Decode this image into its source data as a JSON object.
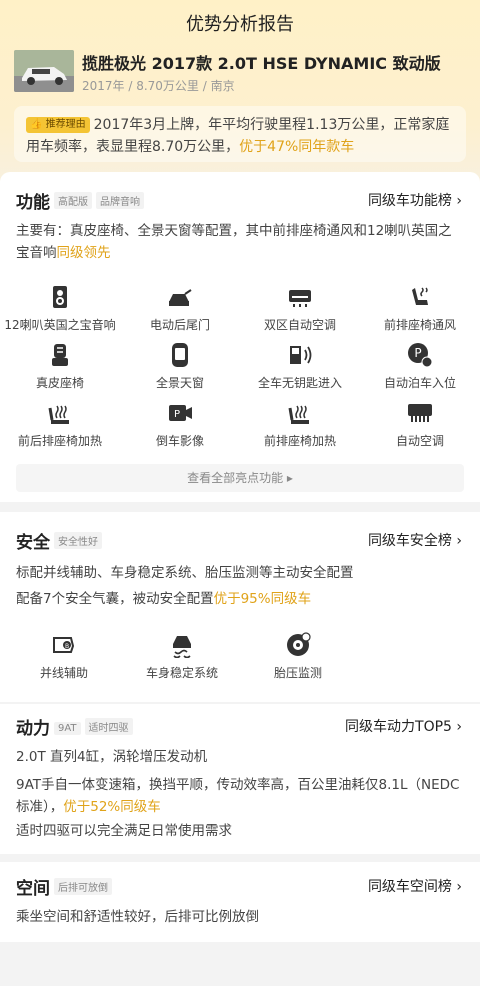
{
  "title": "优势分析报告",
  "car": {
    "name": "揽胜极光 2017款 2.0T HSE DYNAMIC 致动版",
    "meta": "2017年 / 8.70万公里 / 南京"
  },
  "recommend": {
    "badge": "推荐理由",
    "text": "2017年3月上牌，年平均行驶里程1.13万公里，正常家庭用车频率，表显里程8.70万公里，",
    "highlight": "优于47%同年款车"
  },
  "features": {
    "title": "功能",
    "tags": [
      "高配版",
      "品牌音响"
    ],
    "rank": "同级车功能榜",
    "desc": "主要有：真皮座椅、全景天窗等配置，其中前排座椅通风和12喇叭英国之宝音响",
    "desc_hl": "同级领先",
    "items": [
      {
        "label": "12喇叭英国之宝音响",
        "icon": "speaker-icon"
      },
      {
        "label": "电动后尾门",
        "icon": "tailgate-icon"
      },
      {
        "label": "双区自动空调",
        "icon": "ac-icon"
      },
      {
        "label": "前排座椅通风",
        "icon": "seat-vent-icon"
      },
      {
        "label": "真皮座椅",
        "icon": "leather-seat-icon"
      },
      {
        "label": "全景天窗",
        "icon": "sunroof-icon"
      },
      {
        "label": "全车无钥匙进入",
        "icon": "keyless-icon"
      },
      {
        "label": "自动泊车入位",
        "icon": "auto-park-icon"
      },
      {
        "label": "前后排座椅加热",
        "icon": "seat-heat-icon"
      },
      {
        "label": "倒车影像",
        "icon": "reverse-camera-icon"
      },
      {
        "label": "前排座椅加热",
        "icon": "seat-heat-icon"
      },
      {
        "label": "自动空调",
        "icon": "auto-ac-icon"
      }
    ],
    "more": "查看全部亮点功能 ▸"
  },
  "safety": {
    "title": "安全",
    "tag": "安全性好",
    "rank": "同级车安全榜",
    "line1": "标配并线辅助、车身稳定系统、胎压监测等主动安全配置",
    "line2": "配备7个安全气囊，被动安全配置",
    "line2_hl": "优于95%同级车",
    "items": [
      {
        "label": "并线辅助",
        "icon": "lane-assist-icon"
      },
      {
        "label": "车身稳定系统",
        "icon": "esp-icon"
      },
      {
        "label": "胎压监测",
        "icon": "tire-pressure-icon"
      }
    ]
  },
  "power": {
    "title": "动力",
    "tags": [
      "9AT",
      "适时四驱"
    ],
    "rank": "同级车动力TOP5",
    "line1": "2.0T 直列4缸，涡轮增压发动机",
    "line2": "9AT手自一体变速箱，换挡平顺，传动效率高，百公里油耗仅8.1L（NEDC标准），",
    "line2_hl": "优于52%同级车",
    "line3": "适时四驱可以完全满足日常使用需求"
  },
  "space": {
    "title": "空间",
    "tag": "后排可放倒",
    "rank": "同级车空间榜",
    "line1": "乘坐空间和舒适性较好，后排可比例放倒"
  },
  "colors": {
    "accent": "#e0a31a",
    "badge": "#f4c434"
  }
}
